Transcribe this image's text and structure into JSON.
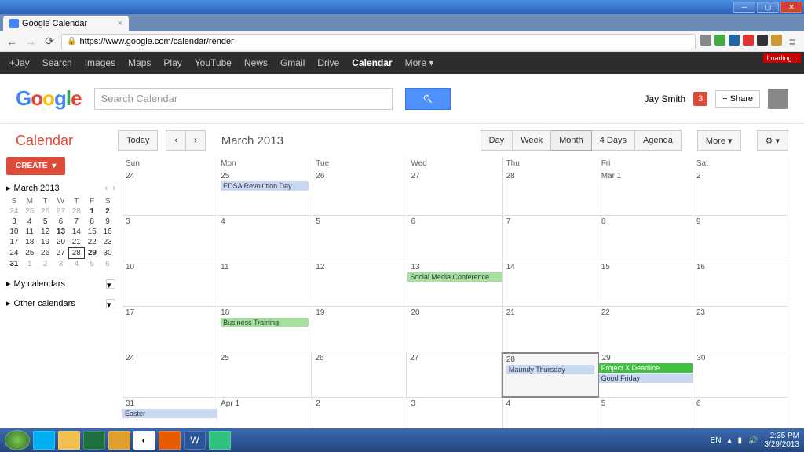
{
  "window": {
    "title": "Google Calendar"
  },
  "browser": {
    "url": "https://www.google.com/calendar/render",
    "loading_label": "Loading..."
  },
  "gbar": {
    "items": [
      "+Jay",
      "Search",
      "Images",
      "Maps",
      "Play",
      "YouTube",
      "News",
      "Gmail",
      "Drive",
      "Calendar",
      "More"
    ],
    "active_index": 9
  },
  "header": {
    "search_placeholder": "Search Calendar",
    "user_name": "Jay Smith",
    "notif_count": "3",
    "share_label": "+ Share"
  },
  "toolbar": {
    "app_title": "Calendar",
    "today_label": "Today",
    "period_label": "March 2013",
    "views": [
      "Day",
      "Week",
      "Month",
      "4 Days",
      "Agenda"
    ],
    "active_view": 2,
    "more_label": "More ▾"
  },
  "sidebar": {
    "create_label": "CREATE",
    "mini_month": "March 2013",
    "dow": [
      "S",
      "M",
      "T",
      "W",
      "T",
      "F",
      "S"
    ],
    "weeks": [
      [
        {
          "n": "24",
          "o": true
        },
        {
          "n": "25",
          "o": true
        },
        {
          "n": "26",
          "o": true
        },
        {
          "n": "27",
          "o": true
        },
        {
          "n": "28",
          "o": true
        },
        {
          "n": "1",
          "b": true
        },
        {
          "n": "2",
          "b": true
        }
      ],
      [
        {
          "n": "3"
        },
        {
          "n": "4"
        },
        {
          "n": "5"
        },
        {
          "n": "6"
        },
        {
          "n": "7"
        },
        {
          "n": "8"
        },
        {
          "n": "9"
        }
      ],
      [
        {
          "n": "10"
        },
        {
          "n": "11"
        },
        {
          "n": "12"
        },
        {
          "n": "13",
          "b": true
        },
        {
          "n": "14"
        },
        {
          "n": "15"
        },
        {
          "n": "16"
        }
      ],
      [
        {
          "n": "17"
        },
        {
          "n": "18"
        },
        {
          "n": "19"
        },
        {
          "n": "20"
        },
        {
          "n": "21"
        },
        {
          "n": "22"
        },
        {
          "n": "23"
        }
      ],
      [
        {
          "n": "24"
        },
        {
          "n": "25"
        },
        {
          "n": "26"
        },
        {
          "n": "27"
        },
        {
          "n": "28",
          "t": true
        },
        {
          "n": "29",
          "b": true
        },
        {
          "n": "30"
        }
      ],
      [
        {
          "n": "31",
          "b": true
        },
        {
          "n": "1",
          "o": true
        },
        {
          "n": "2",
          "o": true
        },
        {
          "n": "3",
          "o": true
        },
        {
          "n": "4",
          "o": true
        },
        {
          "n": "5",
          "o": true
        },
        {
          "n": "6",
          "o": true
        }
      ]
    ],
    "my_calendars_label": "My calendars",
    "other_calendars_label": "Other calendars"
  },
  "calendar": {
    "dow": [
      "Sun",
      "Mon",
      "Tue",
      "Wed",
      "Thu",
      "Fri",
      "Sat"
    ],
    "weeks": [
      [
        {
          "n": "24",
          "other": true
        },
        {
          "n": "25",
          "other": true,
          "events": [
            {
              "t": "EDSA Revolution Day",
              "c": "blue"
            }
          ]
        },
        {
          "n": "26",
          "other": true
        },
        {
          "n": "27",
          "other": true
        },
        {
          "n": "28",
          "other": true
        },
        {
          "n": "Mar 1"
        },
        {
          "n": "2"
        }
      ],
      [
        {
          "n": "3"
        },
        {
          "n": "4"
        },
        {
          "n": "5"
        },
        {
          "n": "6"
        },
        {
          "n": "7"
        },
        {
          "n": "8"
        },
        {
          "n": "9"
        }
      ],
      [
        {
          "n": "10"
        },
        {
          "n": "11"
        },
        {
          "n": "12"
        },
        {
          "n": "13",
          "events": [
            {
              "t": "Social Media Conference",
              "c": "green",
              "full": true
            }
          ]
        },
        {
          "n": "14"
        },
        {
          "n": "15"
        },
        {
          "n": "16"
        }
      ],
      [
        {
          "n": "17"
        },
        {
          "n": "18",
          "events": [
            {
              "t": "Business Training",
              "c": "green"
            }
          ]
        },
        {
          "n": "19"
        },
        {
          "n": "20"
        },
        {
          "n": "21"
        },
        {
          "n": "22"
        },
        {
          "n": "23"
        }
      ],
      [
        {
          "n": "24"
        },
        {
          "n": "25"
        },
        {
          "n": "26"
        },
        {
          "n": "27"
        },
        {
          "n": "28",
          "today": true,
          "events": [
            {
              "t": "Maundy Thursday",
              "c": "blue"
            }
          ]
        },
        {
          "n": "29",
          "events": [
            {
              "t": "Project X Deadline",
              "c": "brightgreen",
              "full": true
            },
            {
              "t": "Good Friday",
              "c": "blue",
              "full": true
            }
          ]
        },
        {
          "n": "30"
        }
      ],
      [
        {
          "n": "31",
          "events": [
            {
              "t": "Easter",
              "c": "blue",
              "full": true
            }
          ]
        },
        {
          "n": "Apr 1",
          "other": true
        },
        {
          "n": "2",
          "other": true
        },
        {
          "n": "3",
          "other": true
        },
        {
          "n": "4",
          "other": true
        },
        {
          "n": "5",
          "other": true
        },
        {
          "n": "6",
          "other": true
        }
      ]
    ]
  },
  "taskbar": {
    "lang": "EN",
    "time": "2:35 PM",
    "date": "3/29/2013"
  }
}
